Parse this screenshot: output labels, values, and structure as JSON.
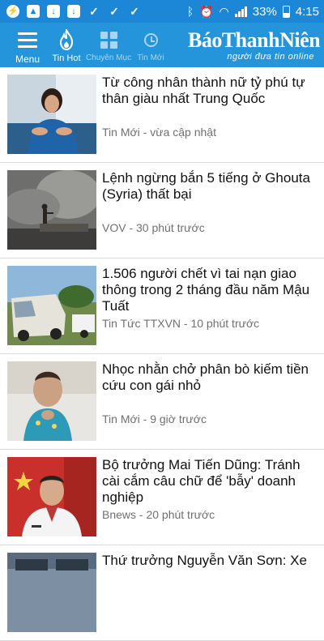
{
  "status_bar": {
    "battery": "33%",
    "time": "4:15",
    "icons": [
      "messenger-icon",
      "image-icon",
      "download-icon",
      "download-icon",
      "vk-icon",
      "vk-icon",
      "vk-icon",
      "bluetooth-icon",
      "alarm-icon",
      "wifi-icon",
      "signal-icon",
      "battery-icon"
    ]
  },
  "nav": {
    "menu_label": "Menu",
    "hot_label": "Tin Hot",
    "category_label": "Chuyên Mục",
    "new_label": "Tin Mới"
  },
  "brand": {
    "name_part1": "Báo",
    "name_part2": "ThanhNiên",
    "tagline": "người đưa tin online"
  },
  "articles": [
    {
      "title": "Từ công nhân thành nữ tỷ phú tự thân giàu nhất Trung Quốc",
      "meta": "Tin Mới - vừa cập nhật"
    },
    {
      "title": "Lệnh ngừng bắn 5 tiếng ở Ghouta (Syria) thất bại",
      "meta": "VOV - 30 phút trước"
    },
    {
      "title": "1.506 người chết vì tai nạn giao thông trong 2 tháng đầu năm Mậu Tuất",
      "meta": "Tin Tức TTXVN - 10 phút trước"
    },
    {
      "title": "Nhọc nhằn chở phân bò kiếm tiền cứu con gái nhỏ",
      "meta": "Tin Mới - 9 giờ trước"
    },
    {
      "title": "Bộ trưởng Mai Tiến Dũng: Tránh cài cắm câu chữ để 'bẫy' doanh nghiệp",
      "meta": "Bnews - 20 phút trước"
    },
    {
      "title": "Thứ trưởng Nguyễn Văn Sơn: Xe",
      "meta": ""
    }
  ]
}
